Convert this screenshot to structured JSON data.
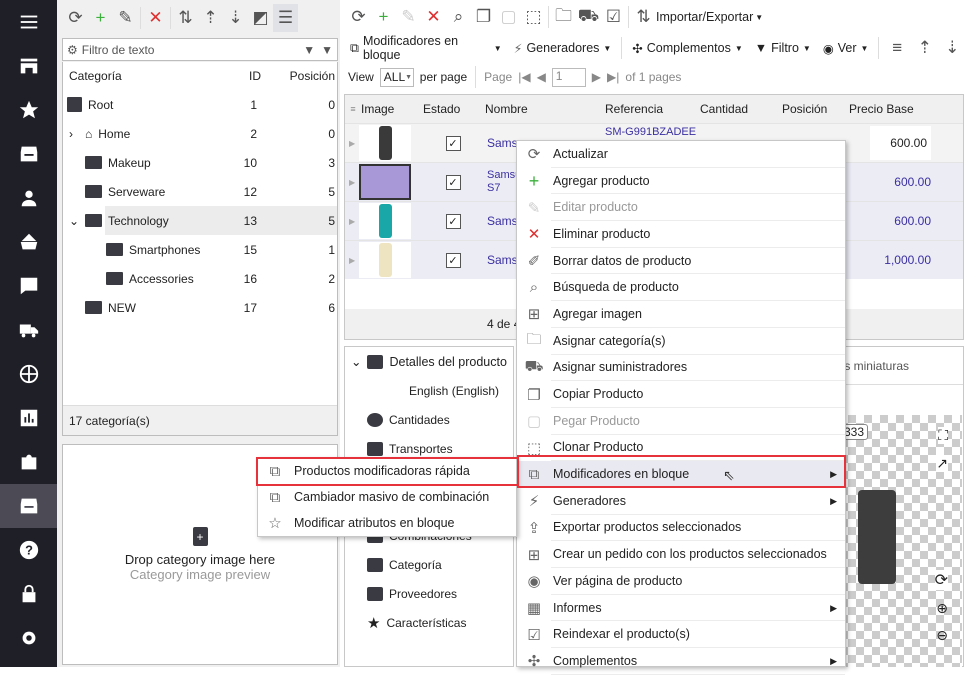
{
  "sidebar": {
    "items": [
      {
        "icon": "menu-icon"
      },
      {
        "icon": "store-icon"
      },
      {
        "icon": "star-icon"
      },
      {
        "icon": "archive-icon"
      },
      {
        "icon": "user-icon"
      },
      {
        "icon": "basket-icon"
      },
      {
        "icon": "chat-icon"
      },
      {
        "icon": "truck-icon"
      },
      {
        "icon": "globe-icon"
      },
      {
        "icon": "chart-icon"
      },
      {
        "icon": "puzzle-icon"
      },
      {
        "icon": "archive-icon",
        "active": true
      },
      {
        "icon": "help-icon"
      },
      {
        "icon": "lock-icon"
      },
      {
        "icon": "gear-icon"
      }
    ]
  },
  "categories": {
    "filter_placeholder": "Filtro de texto",
    "columns": {
      "name": "Categoría",
      "id": "ID",
      "position": "Posición"
    },
    "rows": [
      {
        "name": "Root",
        "id": "1",
        "position": "0"
      },
      {
        "name": "Home",
        "id": "2",
        "position": "0"
      },
      {
        "name": "Makeup",
        "id": "10",
        "position": "3"
      },
      {
        "name": "Serveware",
        "id": "12",
        "position": "5"
      },
      {
        "name": "Technology",
        "id": "13",
        "position": "5"
      },
      {
        "name": "Smartphones",
        "id": "15",
        "position": "1"
      },
      {
        "name": "Accessories",
        "id": "16",
        "position": "2"
      },
      {
        "name": "NEW",
        "id": "17",
        "position": "6"
      }
    ],
    "footer": "17 categoría(s)",
    "image_drop": {
      "title": "Drop category image here",
      "subtitle": "Category image preview"
    }
  },
  "toolbar": {
    "import_export": "Importar/Exportar",
    "bulk_modifiers": "Modificadores en bloque",
    "generators": "Generadores",
    "addons": "Complementos",
    "filter": "Filtro",
    "view": "Ver"
  },
  "pager": {
    "view_label": "View",
    "per_page_value": "ALL",
    "per_page_label": "per page",
    "page_label": "Page",
    "page_value": "1",
    "of_pages": "of 1 pages"
  },
  "grid": {
    "columns": [
      "Image",
      "Estado",
      "Nombre",
      "Referencia",
      "Cantidad",
      "Posición",
      "Precio Base"
    ],
    "rows": [
      {
        "name": "Samsu",
        "reference": "SM-G991BZADEE",
        "price": "600.00",
        "color": "#3a3a3a"
      },
      {
        "name": "Samsu S7",
        "reference": "",
        "price": "600.00",
        "color": "#7a6aa8"
      },
      {
        "name": "Samsu",
        "reference": "",
        "price": "600.00",
        "color": "#1aa7a7"
      },
      {
        "name": "Samsu",
        "reference": "",
        "price": "1,000.00",
        "color": "#eee4c2"
      }
    ],
    "footer": "4 de 4"
  },
  "details": {
    "items": [
      {
        "label": "Detalles del producto"
      },
      {
        "label": "English (English)"
      },
      {
        "label": "Cantidades"
      },
      {
        "label": "Transportes"
      },
      {
        "label": "Combinaciones"
      },
      {
        "label": "Categoría"
      },
      {
        "label": "Proveedores"
      },
      {
        "label": "Características"
      }
    ]
  },
  "preview": {
    "tab_label": "s miniaturas",
    "image_id": "333"
  },
  "context_menu": {
    "items": [
      {
        "label": "Actualizar",
        "icon": "refresh-icon"
      },
      {
        "label": "Agregar producto",
        "icon": "plus-icon"
      },
      {
        "label": "Editar producto",
        "icon": "pencil-icon",
        "disabled": true
      },
      {
        "label": "Eliminar producto",
        "icon": "close-icon"
      },
      {
        "label": "Borrar datos de producto",
        "icon": "eraser-icon"
      },
      {
        "label": "Búsqueda de producto",
        "icon": "search-icon"
      },
      {
        "label": "Agregar imagen",
        "icon": "add-image-icon"
      },
      {
        "label": "Asignar categoría(s)",
        "icon": "folder-check-icon"
      },
      {
        "label": "Asignar suministradores",
        "icon": "supplier-icon"
      },
      {
        "label": "Copiar Producto",
        "icon": "copy-icon"
      },
      {
        "label": "Pegar Producto",
        "icon": "paste-icon",
        "disabled": true
      },
      {
        "label": "Clonar Producto",
        "icon": "clone-icon"
      },
      {
        "label": "Modificadores en bloque",
        "icon": "bulk-icon",
        "submenu": true,
        "highlighted": true
      },
      {
        "label": "Generadores",
        "icon": "bolt-icon",
        "submenu": true
      },
      {
        "label": "Exportar productos seleccionados",
        "icon": "export-icon"
      },
      {
        "label": "Crear un pedido con los productos seleccionados",
        "icon": "order-icon"
      },
      {
        "label": "Ver página de producto",
        "icon": "view-page-icon"
      },
      {
        "label": "Informes",
        "icon": "report-icon",
        "submenu": true
      },
      {
        "label": "Reindexar el producto(s)",
        "icon": "reindex-icon"
      },
      {
        "label": "Complementos",
        "icon": "puzzle-icon",
        "submenu": true
      }
    ]
  },
  "submenu": {
    "items": [
      {
        "label": "Productos modificadoras rápida",
        "icon": "quick-edit-icon",
        "highlighted": true
      },
      {
        "label": "Cambiador masivo de combinación",
        "icon": "combination-icon"
      },
      {
        "label": "Modificar atributos en bloque",
        "icon": "attribute-icon"
      }
    ]
  },
  "colors": {
    "accent": "#3a2fa0",
    "highlight_border": "#e6333b",
    "sidebar_bg": "#1f1f27"
  }
}
